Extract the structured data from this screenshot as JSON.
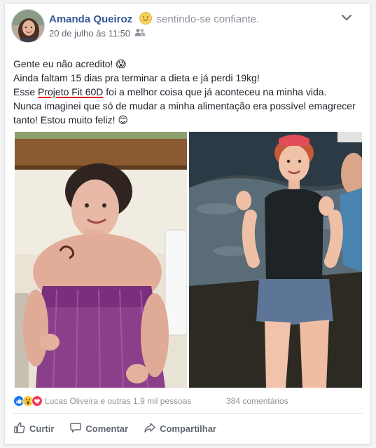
{
  "post": {
    "author": "Amanda Queiroz",
    "feeling": "sentindo-se confiante.",
    "feeling_icon": "smiling-emoji-icon",
    "timestamp": "20 de julho às 11:50",
    "audience_icon": "friends-icon",
    "lines": [
      "Gente eu não acredito! 😱",
      "Ainda faltam 15 dias pra terminar a dieta e já perdi 19kg!",
      "Nunca imaginei que só de mudar a minha alimentação era possível emagrecer tanto! Estou muito feliz! 😊"
    ],
    "line3_prefix": "Esse ",
    "line3_link": "Projeto Fit 60D",
    "line3_suffix": " foi a melhor coisa que já aconteceu na minha vida."
  },
  "reactions": {
    "icons": [
      "like-reaction-icon",
      "wow-reaction-icon",
      "love-reaction-icon"
    ],
    "summary": "Lucas Oliveira e outras 1,9 mil pessoas",
    "comments": "384 comentários"
  },
  "actions": {
    "like": "Curtir",
    "comment": "Comentar",
    "share": "Compartilhar"
  },
  "colors": {
    "name": "#365899",
    "meta": "#616770",
    "underline": "#e0201c",
    "like_blue": "#1877f2",
    "love_red": "#f33e58",
    "wow_yellow": "#f7c53e"
  }
}
